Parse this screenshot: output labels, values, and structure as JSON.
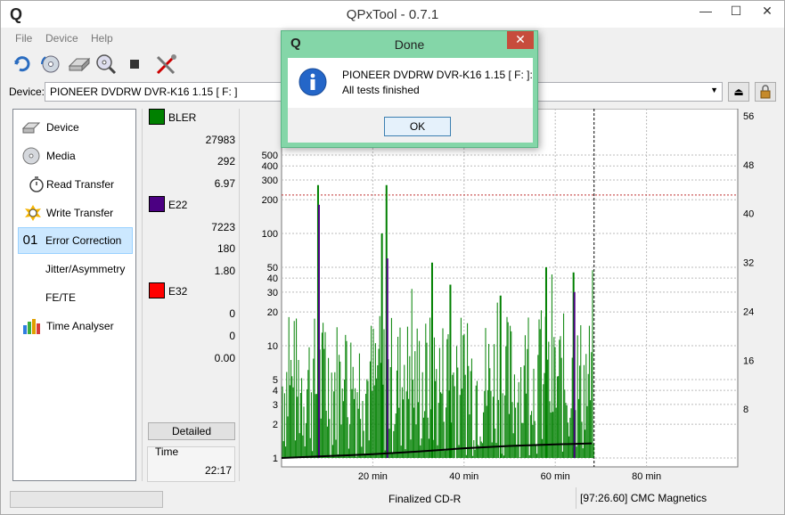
{
  "window": {
    "title": "QPxTool - 0.7.1",
    "logo": "Q",
    "minimize": "—",
    "maximize": "☐",
    "close": "✕"
  },
  "menu": [
    "File",
    "Device",
    "Help"
  ],
  "device": {
    "label": "Device:",
    "value": "PIONEER  DVDRW   DVR-K16  1.15 [ F: ]"
  },
  "nav": [
    {
      "label": "Device",
      "icon": "drive-icon"
    },
    {
      "label": "Media",
      "icon": "disc-icon"
    },
    {
      "label": "Read Transfer",
      "icon": "stopwatch-icon"
    },
    {
      "label": "Write Transfer",
      "icon": "burst-stopwatch-icon"
    },
    {
      "label": "Error Correction",
      "icon": "01"
    },
    {
      "label": "Jitter/Asymmetry",
      "icon": ""
    },
    {
      "label": "FE/TE",
      "icon": ""
    },
    {
      "label": "Time Analyser",
      "icon": "bar-chart-icon"
    }
  ],
  "stats": {
    "bler": {
      "name": "BLER",
      "color": "#008000",
      "total": "27983",
      "max": "292",
      "avg": "6.97"
    },
    "e22": {
      "name": "E22",
      "color": "#4b0082",
      "total": "7223",
      "max": "180",
      "avg": "1.80"
    },
    "e32": {
      "name": "E32",
      "color": "#ff0000",
      "total": "0",
      "max": "0",
      "avg": "0.00"
    }
  },
  "detailed_label": "Detailed",
  "time": {
    "label": "Time",
    "value": "22:17"
  },
  "status": {
    "media": "Finalized CD-R",
    "info": "[97:26.60] CMC Magnetics"
  },
  "dialog": {
    "logo": "Q",
    "title": "Done",
    "close": "✕",
    "line1": "PIONEER  DVDRW   DVR-K16  1.15 [ F: ]:",
    "line2": "All tests finished",
    "ok": "OK"
  },
  "chart_data": {
    "type": "line",
    "y_scale": "log",
    "ylim": [
      1,
      500
    ],
    "yticks": [
      "1",
      "2",
      "3",
      "4",
      "5",
      "10",
      "20",
      "30",
      "40",
      "50",
      "100",
      "200",
      "300",
      "400",
      "500"
    ],
    "y2lim": [
      0,
      56
    ],
    "y2ticks": [
      "8",
      "16",
      "24",
      "32",
      "40",
      "48",
      "56"
    ],
    "xlim": [
      0,
      100
    ],
    "xticks": [
      "20 min",
      "40 min",
      "60 min",
      "80 min"
    ],
    "xtick_values": [
      20,
      40,
      60,
      80
    ],
    "disc_end_min": 68.5,
    "grid": true,
    "threshold": 220,
    "series": [
      {
        "name": "BLER",
        "color": "#008000"
      },
      {
        "name": "E22",
        "color": "#4b0082"
      },
      {
        "name": "E32",
        "color": "#ff0000"
      }
    ],
    "speed_line": {
      "color": "#000000",
      "x": [
        0,
        10,
        20,
        30,
        40,
        50,
        60,
        68
      ],
      "y": [
        1.0,
        1.04,
        1.08,
        1.14,
        1.22,
        1.28,
        1.32,
        1.35
      ]
    },
    "peaks_bler": {
      "x": [
        8,
        22,
        23,
        33,
        37,
        48,
        58,
        64
      ],
      "y": [
        270,
        100,
        270,
        55,
        35,
        28,
        50,
        45
      ]
    },
    "peaks_e22": {
      "x": [
        8,
        23,
        64
      ],
      "y": [
        180,
        60,
        30
      ]
    }
  }
}
